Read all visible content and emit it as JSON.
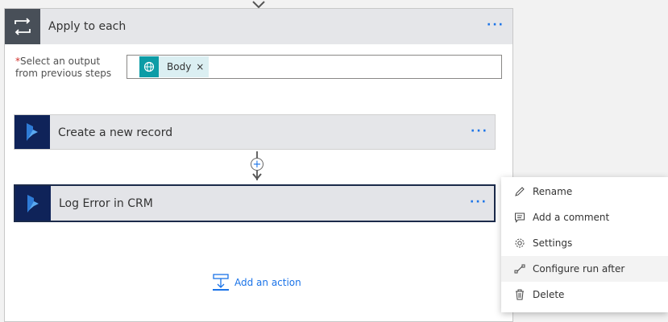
{
  "apply_to_each": {
    "title": "Apply to each",
    "more_label": "···",
    "required_star": "*",
    "select_label_line1": "Select an output",
    "select_label_line2": "from previous steps",
    "token_label": "Body",
    "token_remove": "×"
  },
  "actions": [
    {
      "title": "Create a new record",
      "more_label": "···"
    },
    {
      "title": "Log Error in CRM",
      "more_label": "···"
    }
  ],
  "connector": {
    "plus": "+"
  },
  "add_action": {
    "label": "Add an action"
  },
  "context_menu": {
    "items": [
      {
        "label": "Rename",
        "icon": "pencil-icon"
      },
      {
        "label": "Add a comment",
        "icon": "comment-icon"
      },
      {
        "label": "Settings",
        "icon": "gear-icon"
      },
      {
        "label": "Configure run after",
        "icon": "run-after-icon"
      },
      {
        "label": "Delete",
        "icon": "trash-icon"
      }
    ]
  },
  "colors": {
    "accent": "#1a73e8",
    "loop_icon_bg": "#484f58",
    "dynamics_bg": "#0f2359",
    "token_icon_bg": "#0d9ca6",
    "token_bg": "#dbeff2"
  }
}
